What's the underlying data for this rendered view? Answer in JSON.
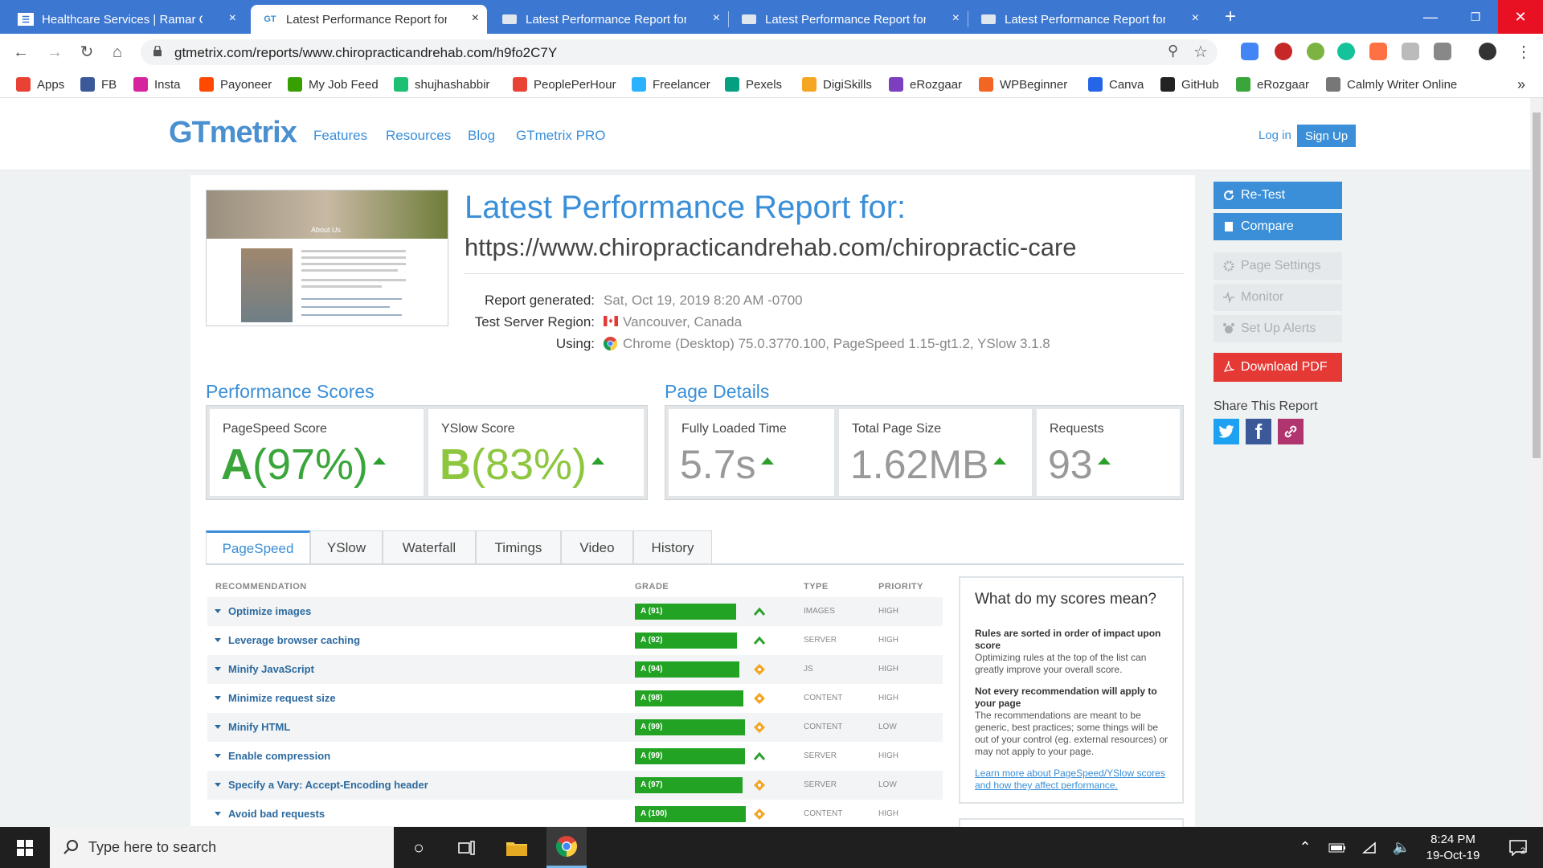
{
  "browser": {
    "tabs": [
      {
        "title": "Healthcare Services | Ramar Chiro",
        "active": false
      },
      {
        "title": "Latest Performance Report for: ht",
        "active": true
      },
      {
        "title": "Latest Performance Report for: ht",
        "active": false
      },
      {
        "title": "Latest Performance Report for: ht",
        "active": false
      },
      {
        "title": "Latest Performance Report for: ht",
        "active": false
      }
    ],
    "close_glyph": "×",
    "new_tab_glyph": "+",
    "url": "gtmetrix.com/reports/www.chiropracticandrehab.com/h9fo2C7Y",
    "bookmarks": [
      {
        "label": "Apps",
        "icon": "apps-grid-icon",
        "color": "#e94235"
      },
      {
        "label": "FB",
        "icon": "facebook-icon",
        "color": "#3b5998"
      },
      {
        "label": "Insta",
        "icon": "instagram-icon",
        "color": "#d6249f"
      },
      {
        "label": "Payoneer",
        "icon": "payoneer-icon",
        "color": "#ff4800"
      },
      {
        "label": "My Job Feed",
        "icon": "upwork-icon",
        "color": "#37a000"
      },
      {
        "label": "shujhashabbir",
        "icon": "fiverr-icon",
        "color": "#1dbf73"
      },
      {
        "label": "PeoplePerHour",
        "icon": "pph-icon",
        "color": "#e94235"
      },
      {
        "label": "Freelancer",
        "icon": "freelancer-icon",
        "color": "#29b2fe"
      },
      {
        "label": "Pexels",
        "icon": "pexels-icon",
        "color": "#05a081"
      },
      {
        "label": "DigiSkills",
        "icon": "digiskills-icon",
        "color": "#f5a623"
      },
      {
        "label": "eRozgaar",
        "icon": "erozgaar-icon",
        "color": "#7b3fbf"
      },
      {
        "label": "WPBeginner",
        "icon": "wpbeginner-icon",
        "color": "#f26522"
      },
      {
        "label": "Canva",
        "icon": "canva-icon",
        "color": "#2566e8"
      },
      {
        "label": "GitHub",
        "icon": "github-icon",
        "color": "#222222"
      },
      {
        "label": "eRozgaar",
        "icon": "erozgaar2-icon",
        "color": "#3aa53a"
      },
      {
        "label": "Calmly Writer Online",
        "icon": "calmly-icon",
        "color": "#777777"
      }
    ],
    "more_glyph": "»"
  },
  "site": {
    "logo": "GTmetrix",
    "nav": [
      "Features",
      "Resources",
      "Blog",
      "GTmetrix PRO"
    ],
    "login": "Log in",
    "signup": "Sign Up"
  },
  "report": {
    "title": "Latest Performance Report for:",
    "url": "https://www.chiropracticandrehab.com/chiropractic-care",
    "meta": [
      {
        "label": "Report generated:",
        "value": "Sat, Oct 19, 2019 8:20 AM -0700"
      },
      {
        "label": "Test Server Region:",
        "value": "Vancouver, Canada"
      },
      {
        "label": "Using:",
        "value": "Chrome (Desktop) 75.0.3770.100, PageSpeed 1.15-gt1.2, YSlow 3.1.8"
      }
    ],
    "thumbnail_text": "About Us",
    "scores_header": "Performance Scores",
    "scores": [
      {
        "label": "PageSpeed Score",
        "grade": "A",
        "pct": "(97%)"
      },
      {
        "label": "YSlow Score",
        "grade": "B",
        "pct": "(83%)"
      }
    ],
    "details_header": "Page Details",
    "details": [
      {
        "label": "Fully Loaded Time",
        "value": "5.7s"
      },
      {
        "label": "Total Page Size",
        "value": "1.62MB"
      },
      {
        "label": "Requests",
        "value": "93"
      }
    ],
    "tabs": [
      "PageSpeed",
      "YSlow",
      "Waterfall",
      "Timings",
      "Video",
      "History"
    ],
    "table_headers": {
      "recommendation": "RECOMMENDATION",
      "grade": "GRADE",
      "type": "TYPE",
      "priority": "PRIORITY"
    },
    "recommendations": [
      {
        "name": "Optimize images",
        "grade": "A (91)",
        "score": 91,
        "trend": "up",
        "type": "IMAGES",
        "priority": "HIGH"
      },
      {
        "name": "Leverage browser caching",
        "grade": "A (92)",
        "score": 92,
        "trend": "up",
        "type": "SERVER",
        "priority": "HIGH"
      },
      {
        "name": "Minify JavaScript",
        "grade": "A (94)",
        "score": 94,
        "trend": "same",
        "type": "JS",
        "priority": "HIGH"
      },
      {
        "name": "Minimize request size",
        "grade": "A (98)",
        "score": 98,
        "trend": "same",
        "type": "CONTENT",
        "priority": "HIGH"
      },
      {
        "name": "Minify HTML",
        "grade": "A (99)",
        "score": 99,
        "trend": "same",
        "type": "CONTENT",
        "priority": "LOW"
      },
      {
        "name": "Enable compression",
        "grade": "A (99)",
        "score": 99,
        "trend": "up",
        "type": "SERVER",
        "priority": "HIGH"
      },
      {
        "name": "Specify a Vary: Accept-Encoding header",
        "grade": "A (97)",
        "score": 97,
        "trend": "same",
        "type": "SERVER",
        "priority": "LOW"
      },
      {
        "name": "Avoid bad requests",
        "grade": "A (100)",
        "score": 100,
        "trend": "same",
        "type": "CONTENT",
        "priority": "HIGH"
      }
    ],
    "info": {
      "title": "What do my scores mean?",
      "p1_bold": "Rules are sorted in order of impact upon score",
      "p1": "Optimizing rules at the top of the list can greatly improve your overall score.",
      "p2_bold": "Not every recommendation will apply to your page",
      "p2": "The recommendations are meant to be generic, best practices; some things will be out of your control (eg. external resources) or may not apply to your page.",
      "link": "Learn more about PageSpeed/YSlow scores and how they affect performance."
    }
  },
  "sidebar": {
    "buttons": [
      {
        "label": "Re-Test",
        "style": "primary",
        "icon": "refresh-icon"
      },
      {
        "label": "Compare",
        "style": "primary",
        "icon": "compare-icon"
      },
      {
        "label": "Page Settings",
        "style": "disabled",
        "icon": "gear-icon"
      },
      {
        "label": "Monitor",
        "style": "disabled",
        "icon": "pulse-icon"
      },
      {
        "label": "Set Up Alerts",
        "style": "disabled",
        "icon": "alarm-icon"
      },
      {
        "label": "Download PDF",
        "style": "danger",
        "icon": "pdf-icon"
      }
    ],
    "share_label": "Share This Report"
  },
  "taskbar": {
    "search_placeholder": "Type here to search",
    "time": "8:24 PM",
    "date": "19-Oct-19",
    "notifications": "2"
  },
  "colors": {
    "brand": "#3a8fd8",
    "grade_green": "#22a324",
    "danger": "#e53935"
  }
}
